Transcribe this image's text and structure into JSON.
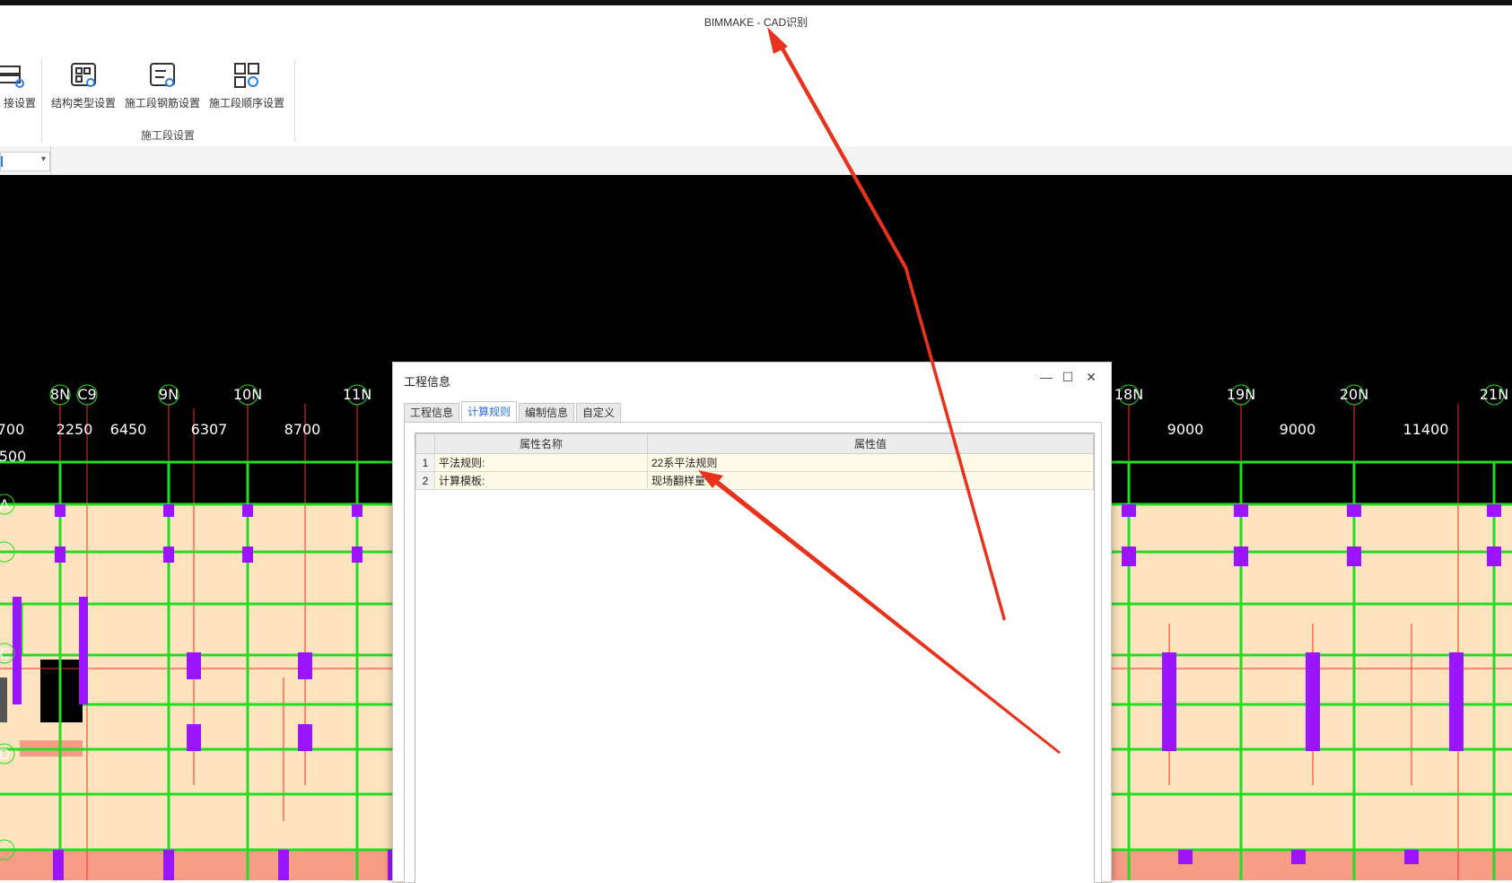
{
  "window": {
    "title": "BIMMAKE - CAD识别"
  },
  "ribbon": {
    "partial_button_label": "接设置",
    "buttons": [
      {
        "label": "结构类型设置",
        "icon": "structure-type-icon"
      },
      {
        "label": "施工段钢筋设置",
        "icon": "rebar-settings-icon"
      },
      {
        "label": "施工段顺序设置",
        "icon": "sequence-settings-icon"
      }
    ],
    "group_label": "施工段设置"
  },
  "subbar": {
    "dropdown_arrow": "▾"
  },
  "drawing": {
    "left_axis_labels": [
      "8N",
      "C9",
      "9N",
      "10N",
      "11N"
    ],
    "right_axis_labels": [
      "18N",
      "19N",
      "20N",
      "21N"
    ],
    "left_dimensions": [
      "700",
      "2250",
      "6450",
      "6307",
      "8700"
    ],
    "right_dimensions": [
      "9000",
      "9000",
      "11400"
    ],
    "left_dim_row2": "500",
    "row_labels": [
      "A",
      "C",
      "D"
    ],
    "colors": {
      "background": "#000000",
      "floor": "#fde4bf",
      "slab_bottom": "#f99c86",
      "beam": "#22dd22",
      "column": "#9b14ff",
      "axis": "#ff2a2a"
    }
  },
  "dialog": {
    "title": "工程信息",
    "controls": {
      "minimize": "—",
      "maximize": "☐",
      "close": "✕"
    },
    "tabs": [
      "工程信息",
      "计算规则",
      "编制信息",
      "自定义"
    ],
    "active_tab": 1,
    "grid": {
      "headers": [
        "属性名称",
        "属性值"
      ],
      "rows": [
        {
          "index": "1",
          "name": "平法规则:",
          "value": "22系平法规则"
        },
        {
          "index": "2",
          "name": "计算模板:",
          "value": "现场翻样量"
        }
      ]
    }
  },
  "annotations": {
    "arrow_color": "#e8321c"
  }
}
